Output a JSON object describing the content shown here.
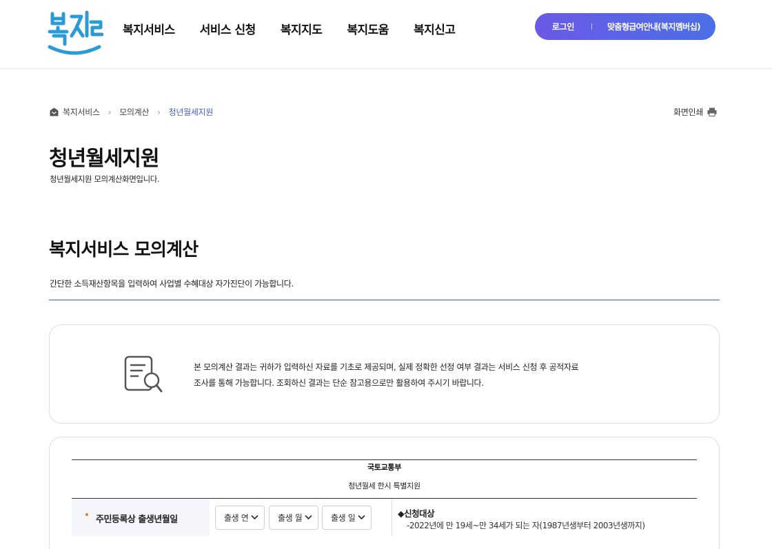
{
  "header": {
    "logo_alt": "복지로",
    "nav": [
      {
        "label": "복지서비스"
      },
      {
        "label": "서비스 신청"
      },
      {
        "label": "복지지도"
      },
      {
        "label": "복지도움"
      },
      {
        "label": "복지신고"
      }
    ],
    "login_label": "로그인",
    "guide_label": "맞춤형급여안내(복지멤버십)"
  },
  "breadcrumb": {
    "items": [
      "복지서비스",
      "모의계산",
      "청년월세지원"
    ],
    "print_label": "화면인쇄"
  },
  "page": {
    "title": "청년월세지원",
    "description": "청년월세지원 모의계산화면입니다."
  },
  "section": {
    "title": "복지서비스 모의계산",
    "description": "간단한 소득재산항목을 입력하여 사업별 수혜대상 자가진단이 가능합니다."
  },
  "notice": {
    "line1": "본 모의계산 결과는 귀하가 입력하신 자료를 기초로 제공되며, 실제 정확한 선정 여부 결과는 서비스 신청 후 공적자료",
    "line2": "조사를 통해 가능합니다. 조회하신 결과는 단순 참고용으로만 활용하여 주시기 바랍니다."
  },
  "calculator": {
    "ministry": "국토교통부",
    "program": "청년월세 한시 특별지원",
    "birth_label": "주민등록상 출생년월일",
    "selects": {
      "year": "출생 연",
      "month": "출생 월",
      "day": "출생 일"
    },
    "target_title": "◆신청대상",
    "target_desc": "-2022년에 만 19세~만 34세가 되는 자(1987년생부터 2003년생까지)"
  },
  "colors": {
    "brand_gradient_start": "#6a5ae6",
    "brand_gradient_end": "#4c6ee6",
    "breadcrumb_current": "#4a5fc1",
    "section_line": "#2a6a84",
    "bullet": "#f07a1f"
  }
}
